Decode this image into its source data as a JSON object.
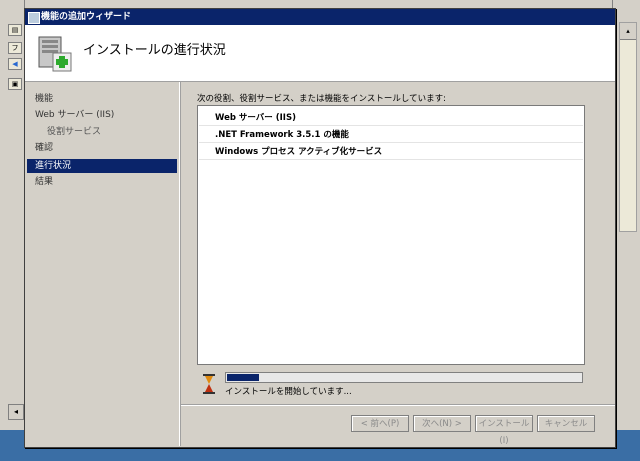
{
  "dialog": {
    "title": "機能の追加ウィザード",
    "header_title": "インストールの進行状況"
  },
  "nav": {
    "items": [
      {
        "label": "機能",
        "state": "normal"
      },
      {
        "label": "Web サーバー (IIS)",
        "state": "normal"
      },
      {
        "label": "役割サービス",
        "state": "sub"
      },
      {
        "label": "確認",
        "state": "normal"
      },
      {
        "label": "進行状況",
        "state": "active"
      },
      {
        "label": "結果",
        "state": "normal"
      }
    ]
  },
  "main": {
    "intro": "次の役割、役割サービス、または機能をインストールしています:",
    "install_items": [
      "Web サーバー (IIS)",
      ".NET Framework 3.5.1 の機能",
      "Windows プロセス アクティブ化サービス"
    ],
    "progress_fraction": 0.09,
    "progress_text": "インストールを開始しています..."
  },
  "buttons": {
    "back": "< 前へ(P)",
    "next": "次へ(N) >",
    "install": "インストール(I)",
    "cancel": "キャンセル"
  },
  "background": {
    "mini_label": "フ"
  },
  "colors": {
    "titlebar": "#0a246a",
    "selection": "#0a246a",
    "desktop": "#3a6ea5"
  }
}
